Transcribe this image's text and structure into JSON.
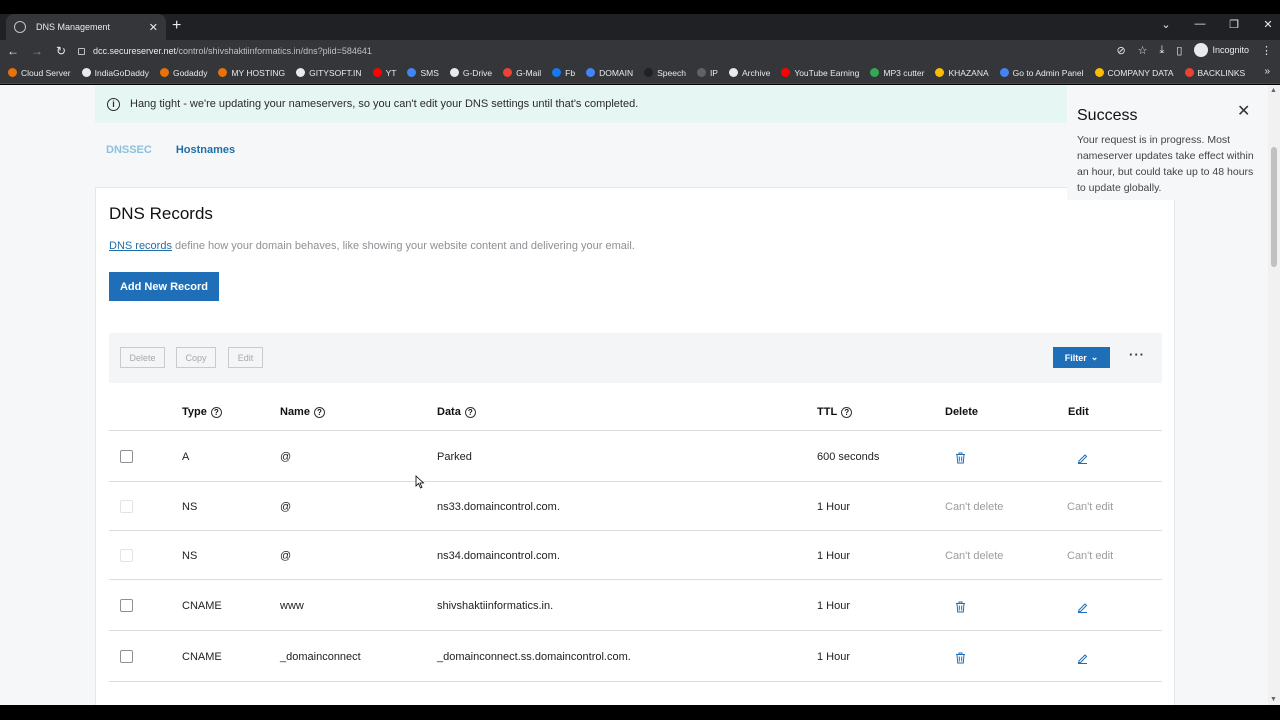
{
  "browser": {
    "tab_title": "DNS Management",
    "new_tab": "+",
    "url_host": "dcc.secureserver.net",
    "url_path": "/control/shivshaktiinformatics.in/dns?plid=584641",
    "profile_label": "Incognito"
  },
  "bookmarks": [
    {
      "label": "Cloud Server",
      "color": "#e8710a"
    },
    {
      "label": "IndiaGoDaddy",
      "color": "#e8eaed"
    },
    {
      "label": "Godaddy",
      "color": "#e8710a"
    },
    {
      "label": "MY HOSTING",
      "color": "#e8710a"
    },
    {
      "label": "GITYSOFT.IN",
      "color": "#e8eaed"
    },
    {
      "label": "YT",
      "color": "#ff0000"
    },
    {
      "label": "SMS",
      "color": "#4285f4"
    },
    {
      "label": "G-Drive",
      "color": "#e8eaed"
    },
    {
      "label": "G-Mail",
      "color": "#ea4335"
    },
    {
      "label": "Fb",
      "color": "#1877f2"
    },
    {
      "label": "DOMAIN",
      "color": "#4285f4"
    },
    {
      "label": "Speech",
      "color": "#202124"
    },
    {
      "label": "IP",
      "color": "#5f6368"
    },
    {
      "label": "Archive",
      "color": "#e8eaed"
    },
    {
      "label": "YouTube Earning",
      "color": "#ff0000"
    },
    {
      "label": "MP3 cutter",
      "color": "#34a853"
    },
    {
      "label": "KHAZANA",
      "color": "#fbbc04"
    },
    {
      "label": "Go to Admin Panel",
      "color": "#4285f4"
    },
    {
      "label": "COMPANY DATA",
      "color": "#fbbc04"
    },
    {
      "label": "BACKLINKS",
      "color": "#ea4335"
    }
  ],
  "notice": {
    "text": "Hang tight - we're updating your nameservers, so you can't edit your DNS settings until that's completed."
  },
  "subtabs": [
    "DNSSEC",
    "Hostnames"
  ],
  "panel": {
    "title": "DNS Records",
    "desc_link": "DNS records",
    "desc_rest": " define how your domain behaves, like showing your website content and delivering your email.",
    "add_button": "Add New Record"
  },
  "toolbar": {
    "delete": "Delete",
    "copy": "Copy",
    "edit": "Edit",
    "filter": "Filter",
    "more": "···"
  },
  "table": {
    "headers": {
      "type": "Type",
      "name": "Name",
      "data": "Data",
      "ttl": "TTL",
      "delete": "Delete",
      "edit": "Edit"
    },
    "rows": [
      {
        "type": "A",
        "name": "@",
        "data": "Parked",
        "ttl": "600 seconds",
        "delete": "",
        "edit": "",
        "editable": true
      },
      {
        "type": "NS",
        "name": "@",
        "data": "ns33.domaincontrol.com.",
        "ttl": "1 Hour",
        "delete": "Can't delete",
        "edit": "Can't edit",
        "editable": false
      },
      {
        "type": "NS",
        "name": "@",
        "data": "ns34.domaincontrol.com.",
        "ttl": "1 Hour",
        "delete": "Can't delete",
        "edit": "Can't edit",
        "editable": false
      },
      {
        "type": "CNAME",
        "name": "www",
        "data": "shivshaktiinformatics.in.",
        "ttl": "1 Hour",
        "delete": "",
        "edit": "",
        "editable": true
      },
      {
        "type": "CNAME",
        "name": "_domainconnect",
        "data": "_domainconnect.ss.domaincontrol.com.",
        "ttl": "1 Hour",
        "delete": "",
        "edit": "",
        "editable": true
      }
    ]
  },
  "toast": {
    "title": "Success",
    "body": "Your request is in progress. Most nameserver updates take effect within an hour, but could take up to 48 hours to update globally."
  },
  "colors": {
    "primary": "#1f6fb8",
    "notice_bg": "#e6f6f2",
    "link": "#1f6fa8"
  }
}
